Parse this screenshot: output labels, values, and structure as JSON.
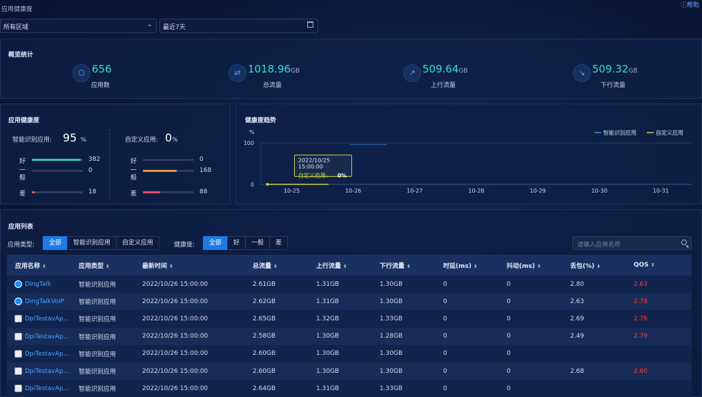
{
  "page": {
    "title": "应用健康度",
    "help_label": "帮助"
  },
  "filters": {
    "region": "所有区域",
    "date_range": "最近7天"
  },
  "overview": {
    "title": "概览统计",
    "stats": [
      {
        "value": "656",
        "unit": "",
        "label": "应用数",
        "icon": "cube-icon"
      },
      {
        "value": "1018.96",
        "unit": "GB",
        "label": "总流量",
        "icon": "swap-arrows-icon"
      },
      {
        "value": "509.64",
        "unit": "GB",
        "label": "上行流量",
        "icon": "trend-up-icon"
      },
      {
        "value": "509.32",
        "unit": "GB",
        "label": "下行流量",
        "icon": "trend-down-icon"
      }
    ]
  },
  "health": {
    "title": "应用健康度",
    "smart": {
      "label": "智能识别应用:",
      "value": "95",
      "unit": "%",
      "rows": [
        {
          "label": "好",
          "value": "382",
          "fraction": 0.955,
          "color": "#2fc3b8"
        },
        {
          "label": "一般",
          "value": "0",
          "fraction": 0.0,
          "color": "#e39a3b"
        },
        {
          "label": "差",
          "value": "18",
          "fraction": 0.045,
          "color": "#e5506a"
        }
      ]
    },
    "custom": {
      "label": "自定义应用:",
      "value": "0",
      "unit": "%",
      "rows": [
        {
          "label": "好",
          "value": "0",
          "fraction": 0.0,
          "color": "#2fc3b8"
        },
        {
          "label": "一般",
          "value": "168",
          "fraction": 0.66,
          "color": "#e39a3b"
        },
        {
          "label": "差",
          "value": "88",
          "fraction": 0.34,
          "color": "#e5506a"
        }
      ]
    }
  },
  "trend": {
    "title": "健康度趋势",
    "tooltip": {
      "time": "2022/10/25 15:00:00",
      "series": "自定义应用:",
      "value": "0%"
    }
  },
  "chart_data": {
    "type": "line",
    "title": "",
    "ylabel": "%",
    "xlabel": "",
    "ylim": [
      0,
      100
    ],
    "yticks": [
      "0",
      "100"
    ],
    "categories": [
      "10-25",
      "10-26",
      "10-27",
      "10-28",
      "10-29",
      "10-30",
      "10-31"
    ],
    "legend_position": "top-right",
    "series": [
      {
        "name": "智能识别应用",
        "color": "#3f8de8",
        "x": [
          0.95,
          1.55
        ],
        "values": [
          96,
          96
        ]
      },
      {
        "name": "自定义应用",
        "color": "#c8d63a",
        "x": [
          -0.4,
          0.6
        ],
        "values": [
          0,
          0
        ]
      }
    ]
  },
  "list": {
    "title": "应用列表",
    "type_label": "应用类型:",
    "type_options": [
      "全部",
      "智能识别应用",
      "自定义应用"
    ],
    "health_label": "健康度:",
    "health_options": [
      "全部",
      "好",
      "一般",
      "差"
    ],
    "search_placeholder": "请输入应用名称",
    "columns": [
      "应用名称",
      "应用类型",
      "最新时间",
      "总流量",
      "上行流量",
      "下行流量",
      "时延(ms)",
      "抖动(ms)",
      "丢包(%)",
      "QOS"
    ],
    "rows": [
      {
        "icon": "ding",
        "cells": [
          "DingTalk",
          "智能识别应用",
          "2022/10/26 15:00:00",
          "2.61GB",
          "1.31GB",
          "1.30GB",
          "0",
          "0",
          "2.80",
          "2.63"
        ]
      },
      {
        "icon": "ding",
        "cells": [
          "DingTalkVoIP",
          "智能识别应用",
          "2022/10/26 15:00:00",
          "2.62GB",
          "1.31GB",
          "1.30GB",
          "0",
          "0",
          "2.63",
          "2.78"
        ]
      },
      {
        "icon": "dpi",
        "cells": [
          "DpiTestavAp...",
          "智能识别应用",
          "2022/10/26 15:00:00",
          "2.65GB",
          "1.32GB",
          "1.33GB",
          "0",
          "0",
          "2.69",
          "2.76"
        ]
      },
      {
        "icon": "dpi",
        "cells": [
          "DpiTestavAp...",
          "智能识别应用",
          "2022/10/26 15:00:00",
          "2.58GB",
          "1.30GB",
          "1.28GB",
          "0",
          "0",
          "2.49",
          "2.79"
        ]
      },
      {
        "icon": "dpi",
        "cells": [
          "DpiTestavAp...",
          "智能识别应用",
          "2022/10/26 15:00:00",
          "2.60GB",
          "1.30GB",
          "1.30GB",
          "0",
          "0",
          "",
          ""
        ]
      },
      {
        "icon": "dpi",
        "cells": [
          "DpiTestavAp...",
          "智能识别应用",
          "2022/10/26 15:00:00",
          "2.60GB",
          "1.30GB",
          "1.30GB",
          "0",
          "0",
          "2.68",
          "2.60"
        ]
      },
      {
        "icon": "dpi",
        "cells": [
          "DpiTestavAp...",
          "智能识别应用",
          "2022/10/26 15:00:00",
          "2.64GB",
          "1.31GB",
          "1.33GB",
          "0",
          "0",
          "",
          ""
        ]
      }
    ]
  }
}
